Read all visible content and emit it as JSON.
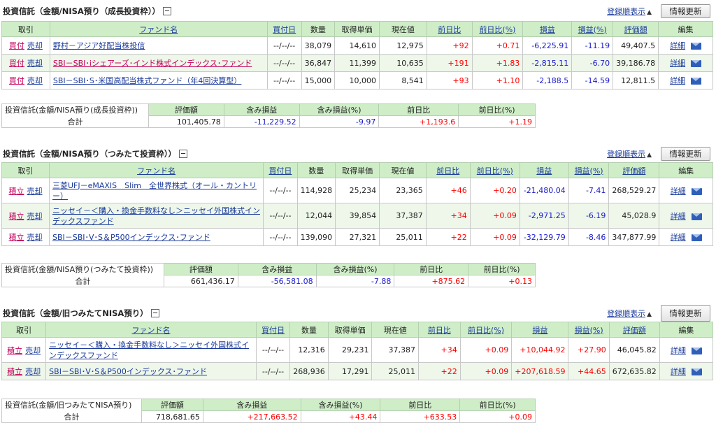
{
  "common": {
    "sort_link": "登録順表示",
    "sort_mark": "▲",
    "refresh": "情報更新",
    "headers": {
      "trade": "取引",
      "fund": "ファンド名",
      "buy_date": "買付日",
      "qty": "数量",
      "unit_cost": "取得単価",
      "price": "現在値",
      "dod": "前日比",
      "dod_pct": "前日比(%)",
      "pl": "損益",
      "pl_pct": "損益(%)",
      "value": "評価額",
      "edit": "編集"
    },
    "sum_headers": {
      "value": "評価額",
      "unreal": "含み損益",
      "unreal_pct": "含み損益(%)",
      "dod": "前日比",
      "dod_pct": "前日比(%)"
    },
    "total_label": "合計",
    "detail": "詳細"
  },
  "sections": [
    {
      "title": "投資信託（金額/NISA預り（成長投資枠））",
      "sum_label": "投資信託(金額/NISA預り(成長投資枠))",
      "rows": [
        {
          "trade1": "買付",
          "trade2": "売却",
          "fund": "野村－アジア好配当株投信",
          "date": "--/--/--",
          "qty": "38,079",
          "cost": "14,610",
          "price": "12,975",
          "dod": "+92",
          "dod_pct": "+0.71",
          "pl": "-6,225.91",
          "pl_pct": "-11.19",
          "value": "49,407.5"
        },
        {
          "trade1": "買付",
          "trade2": "売却",
          "fund": "SBI－SBI･iシェアーズ･インド株式インデックス･ファンド",
          "date": "--/--/--",
          "qty": "36,847",
          "cost": "11,399",
          "price": "10,635",
          "dod": "+191",
          "dod_pct": "+1.83",
          "pl": "-2,815.11",
          "pl_pct": "-6.70",
          "value": "39,186.78"
        },
        {
          "trade1": "買付",
          "trade2": "売却",
          "fund": "SBI－SBI･S･米国高配当株式ファンド（年4回決算型）",
          "date": "--/--/--",
          "qty": "15,000",
          "cost": "10,000",
          "price": "8,541",
          "dod": "+93",
          "dod_pct": "+1.10",
          "pl": "-2,188.5",
          "pl_pct": "-14.59",
          "value": "12,811.5"
        }
      ],
      "sum": {
        "value": "101,405.78",
        "unreal": "-11,229.52",
        "unreal_pct": "-9.97",
        "dod": "+1,193.6",
        "dod_pct": "+1.19"
      }
    },
    {
      "title": "投資信託（金額/NISA預り（つみたて投資枠））",
      "sum_label": "投資信託(金額/NISA預り(つみたて投資枠))",
      "rows": [
        {
          "trade1": "積立",
          "trade2": "売却",
          "fund": "三菱UFJ－eMAXIS　Slim　全世界株式（オール・カントリー）",
          "date": "--/--/--",
          "qty": "114,928",
          "cost": "25,234",
          "price": "23,365",
          "dod": "+46",
          "dod_pct": "+0.20",
          "pl": "-21,480.04",
          "pl_pct": "-7.41",
          "value": "268,529.27"
        },
        {
          "trade1": "積立",
          "trade2": "売却",
          "fund": "ニッセイ－＜購入・換金手数料なし＞ニッセイ外国株式インデックスファンド",
          "date": "--/--/--",
          "qty": "12,044",
          "cost": "39,854",
          "price": "37,387",
          "dod": "+34",
          "dod_pct": "+0.09",
          "pl": "-2,971.25",
          "pl_pct": "-6.19",
          "value": "45,028.9"
        },
        {
          "trade1": "積立",
          "trade2": "売却",
          "fund": "SBI－SBI･V･S＆P500インデックス･ファンド",
          "date": "--/--/--",
          "qty": "139,090",
          "cost": "27,321",
          "price": "25,011",
          "dod": "+22",
          "dod_pct": "+0.09",
          "pl": "-32,129.79",
          "pl_pct": "-8.46",
          "value": "347,877.99"
        }
      ],
      "sum": {
        "value": "661,436.17",
        "unreal": "-56,581.08",
        "unreal_pct": "-7.88",
        "dod": "+875.62",
        "dod_pct": "+0.13"
      }
    },
    {
      "title": "投資信託（金額/旧つみたてNISA預り）",
      "sum_label": "投資信託(金額/旧つみたてNISA預り)",
      "rows": [
        {
          "trade1": "積立",
          "trade2": "売却",
          "fund": "ニッセイ－＜購入・換金手数料なし＞ニッセイ外国株式インデックスファンド",
          "date": "--/--/--",
          "qty": "12,316",
          "cost": "29,231",
          "price": "37,387",
          "dod": "+34",
          "dod_pct": "+0.09",
          "pl": "+10,044.92",
          "pl_pct": "+27.90",
          "value": "46,045.82"
        },
        {
          "trade1": "積立",
          "trade2": "売却",
          "fund": "SBI－SBI･V･S＆P500インデックス･ファンド",
          "date": "--/--/--",
          "qty": "268,936",
          "cost": "17,291",
          "price": "25,011",
          "dod": "+22",
          "dod_pct": "+0.09",
          "pl": "+207,618.59",
          "pl_pct": "+44.65",
          "value": "672,635.82"
        }
      ],
      "sum": {
        "value": "718,681.65",
        "unreal": "+217,663.52",
        "unreal_pct": "+43.44",
        "dod": "+633.53",
        "dod_pct": "+0.09"
      }
    }
  ]
}
